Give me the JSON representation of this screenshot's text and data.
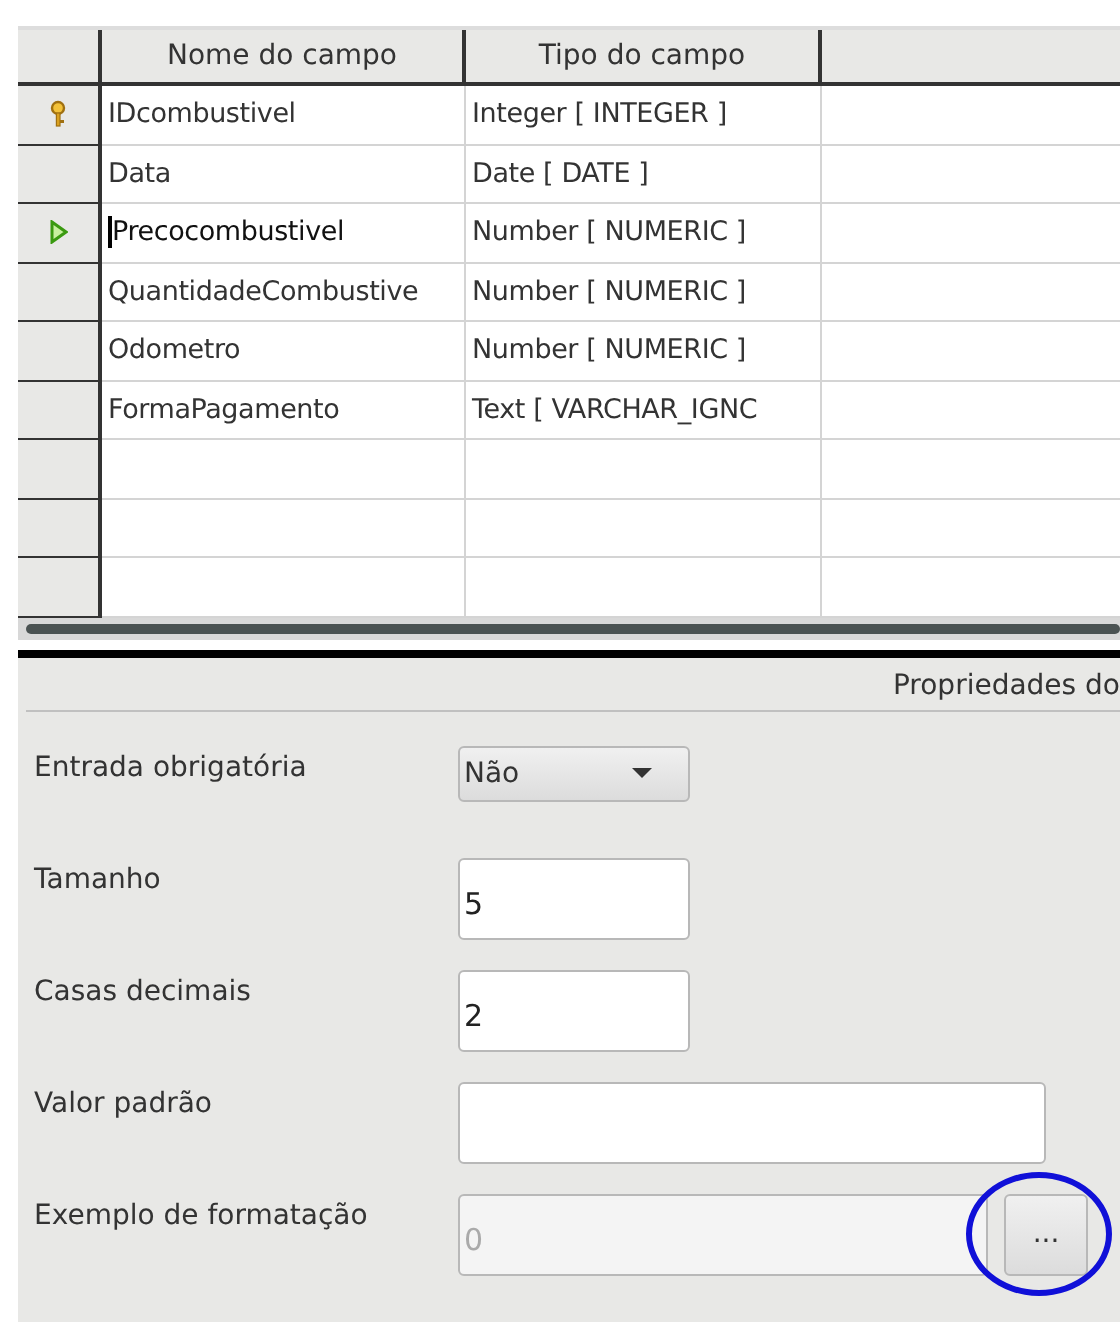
{
  "table": {
    "columns": [
      "Nome do campo",
      "Tipo do campo"
    ],
    "rows": [
      {
        "name": "IDcombustivel",
        "type": "Integer [ INTEGER ]",
        "primary_key": true,
        "current": false
      },
      {
        "name": "Data",
        "type": "Date [ DATE ]",
        "primary_key": false,
        "current": false
      },
      {
        "name": "Precocombustivel",
        "type": "Number [ NUMERIC ]",
        "primary_key": false,
        "current": true
      },
      {
        "name": "QuantidadeCombustive",
        "type": "Number [ NUMERIC ]",
        "primary_key": false,
        "current": false
      },
      {
        "name": "Odometro",
        "type": "Number [ NUMERIC ]",
        "primary_key": false,
        "current": false
      },
      {
        "name": "FormaPagamento",
        "type": "Text [ VARCHAR_IGNC",
        "primary_key": false,
        "current": false
      }
    ]
  },
  "properties": {
    "title": "Propriedades do",
    "fields": [
      {
        "kind": "dropdown",
        "label": "Entrada obrigatória",
        "value": "Não"
      },
      {
        "kind": "input",
        "label": "Tamanho",
        "value": "5"
      },
      {
        "kind": "input",
        "label": "Casas decimais",
        "value": "2"
      },
      {
        "kind": "wide-input",
        "label": "Valor padrão"
      },
      {
        "kind": "format",
        "label": "Exemplo de formatação",
        "value": "0",
        "disabled": true,
        "button": "...",
        "highlighted": true
      }
    ]
  }
}
